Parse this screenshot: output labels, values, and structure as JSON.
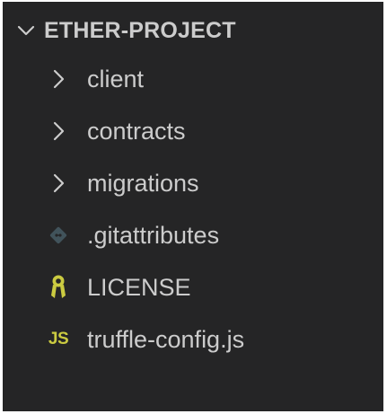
{
  "explorer": {
    "root": {
      "title": "ETHER-PROJECT",
      "icon": "chevron-down-icon",
      "expanded": true
    },
    "items": [
      {
        "label": "client",
        "type": "folder",
        "icon": "chevron-right-icon"
      },
      {
        "label": "contracts",
        "type": "folder",
        "icon": "chevron-right-icon"
      },
      {
        "label": "migrations",
        "type": "folder",
        "icon": "chevron-right-icon"
      },
      {
        "label": ".gitattributes",
        "type": "file",
        "icon": "git-icon"
      },
      {
        "label": "LICENSE",
        "type": "file",
        "icon": "license-icon"
      },
      {
        "label": "truffle-config.js",
        "type": "file",
        "icon": "javascript-icon",
        "icon_text": "JS"
      }
    ]
  },
  "colors": {
    "panel_background": "#252526",
    "text": "#cccccc",
    "git_icon": "#41535b",
    "license_icon": "#cbcb41",
    "js_icon": "#cbcb41"
  }
}
